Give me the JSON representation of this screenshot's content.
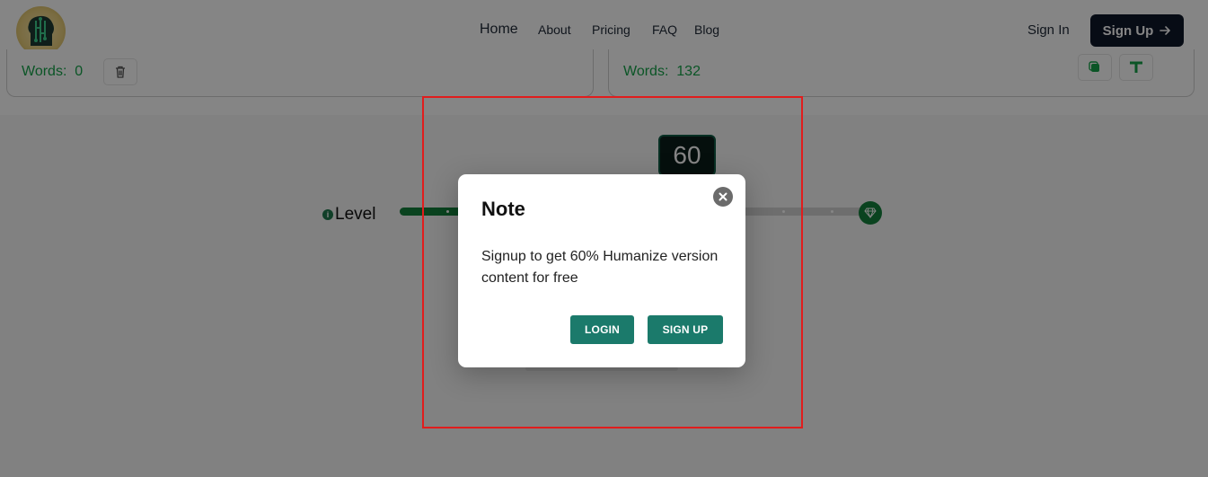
{
  "header": {
    "nav": [
      "Home",
      "About",
      "Pricing",
      "FAQ",
      "Blog"
    ],
    "sign_in": "Sign In",
    "sign_up": "Sign Up",
    "sign_up_icon": "arrow-right-icon"
  },
  "editor": {
    "left_words_label": "Words:",
    "left_words_count": "0",
    "right_words_label": "Words:",
    "right_words_count": "132"
  },
  "level": {
    "label": "Level",
    "value": "60",
    "fill_fraction": 0.6,
    "end_icon": "diamond-icon"
  },
  "modal": {
    "title": "Note",
    "message": "Signup to get 60% Humanize version content for free",
    "login_button": "LOGIN",
    "signup_button": "SIGN UP",
    "close_icon": "close-icon"
  },
  "colors": {
    "accent_green": "#15803d",
    "modal_button": "#1b7a6b",
    "primary_dark": "#0f172a",
    "highlight_border": "#e11d1d"
  }
}
